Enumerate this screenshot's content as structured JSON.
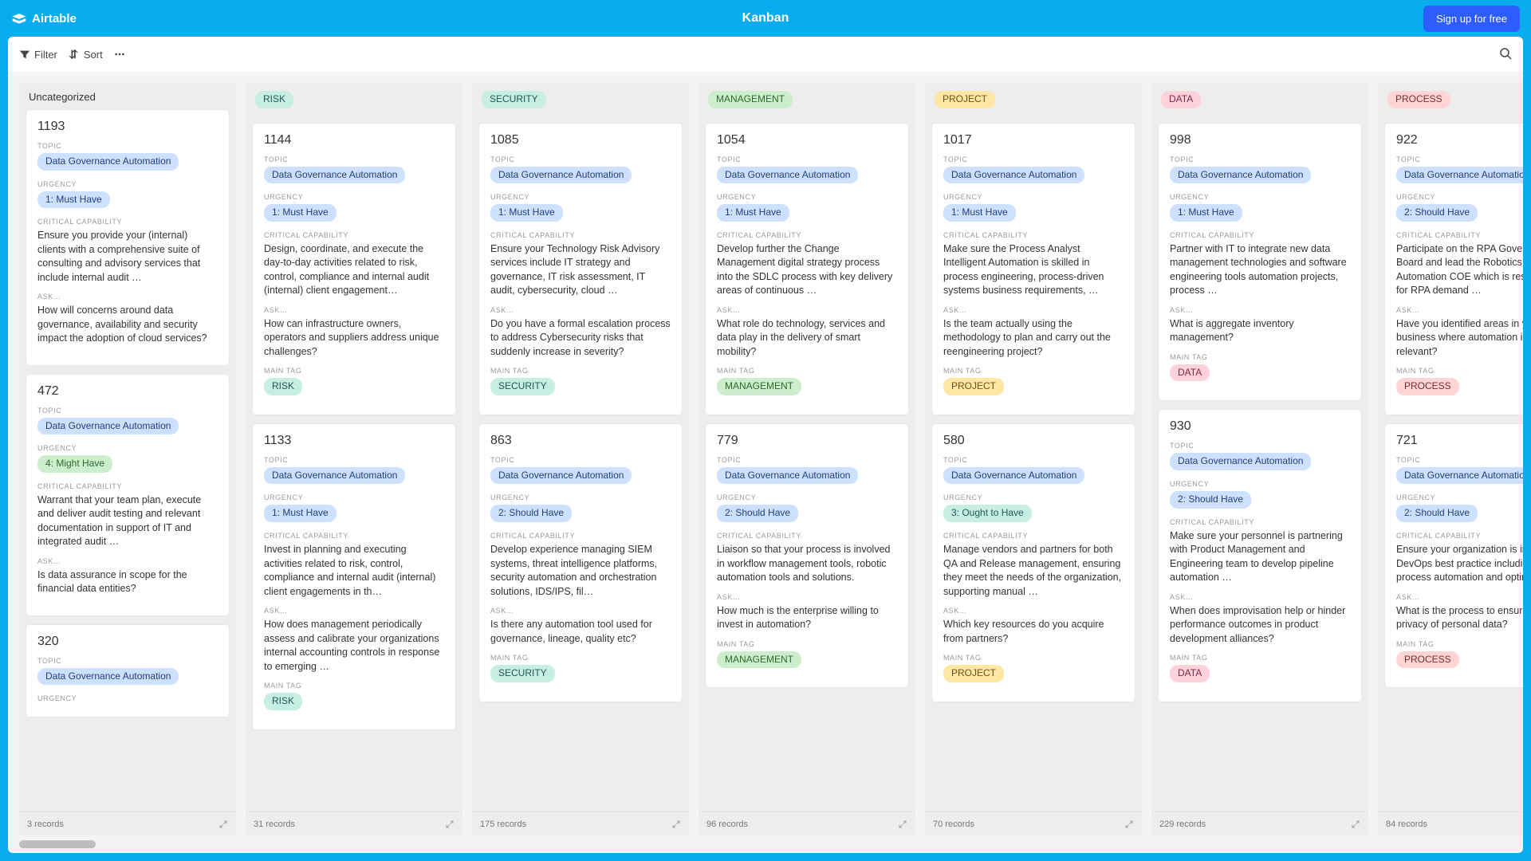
{
  "app": {
    "name": "Airtable",
    "view_title": "Kanban",
    "signup_label": "Sign up for free"
  },
  "toolbar": {
    "filter": "Filter",
    "sort": "Sort"
  },
  "labels": {
    "topic": "TOPIC",
    "urgency": "URGENCY",
    "critical": "CRITICAL CAPABILITY",
    "ask": "ASK…",
    "maintag": "MAIN TAG"
  },
  "pill_for_urgency": {
    "1: Must Have": "pill-blue",
    "2: Should Have": "pill-blue",
    "3: Ought to Have": "pill-teal",
    "4: Might Have": "pill-green"
  },
  "pill_for_tag": {
    "RISK": "pill-teal",
    "SECURITY": "pill-teal",
    "MANAGEMENT": "pill-green",
    "PROJECT": "pill-yellow",
    "DATA": "pill-pink",
    "PROCESS": "pill-red"
  },
  "columns": [
    {
      "key": "uncat",
      "title": "Uncategorized",
      "title_pill": null,
      "records_label": "3 records",
      "cards": [
        {
          "id": "1193",
          "topic": "Data Governance Automation",
          "urgency": "1: Must Have",
          "critical": "Ensure you provide your (internal) clients with a comprehensive suite of consulting and advisory services that include internal audit …",
          "ask": "How will concerns around data governance, availability and security impact the adoption of cloud services?",
          "main_tag": null
        },
        {
          "id": "472",
          "topic": "Data Governance Automation",
          "urgency": "4: Might Have",
          "critical": "Warrant that your team plan, execute and deliver audit testing and relevant documentation in support of IT and integrated audit …",
          "ask": "Is data assurance in scope for the financial data entities?",
          "main_tag": null
        },
        {
          "id": "320",
          "topic": "Data Governance Automation",
          "urgency": "",
          "critical": "",
          "ask": "",
          "main_tag": null,
          "truncated": true
        }
      ]
    },
    {
      "key": "risk",
      "title": "RISK",
      "title_pill": "pill-teal",
      "records_label": "31 records",
      "cards": [
        {
          "id": "1144",
          "topic": "Data Governance Automation",
          "urgency": "1: Must Have",
          "critical": "Design, coordinate, and execute the day-to-day activities related to risk, control, compliance and internal audit (internal) client engagement…",
          "ask": "How can infrastructure owners, operators and suppliers address unique challenges?",
          "main_tag": "RISK"
        },
        {
          "id": "1133",
          "topic": "Data Governance Automation",
          "urgency": "1: Must Have",
          "critical": "Invest in planning and executing activities related to risk, control, compliance and internal audit (internal) client engagements in th…",
          "ask": "How does management periodically assess and calibrate your organizations internal accounting controls in response to emerging …",
          "main_tag": "RISK"
        }
      ]
    },
    {
      "key": "security",
      "title": "SECURITY",
      "title_pill": "pill-teal",
      "records_label": "175 records",
      "cards": [
        {
          "id": "1085",
          "topic": "Data Governance Automation",
          "urgency": "1: Must Have",
          "critical": "Ensure your Technology Risk Advisory services include IT strategy and governance, IT risk assessment, IT audit, cybersecurity, cloud …",
          "ask": "Do you have a formal escalation process to address Cybersecurity risks that suddenly increase in severity?",
          "main_tag": "SECURITY"
        },
        {
          "id": "863",
          "topic": "Data Governance Automation",
          "urgency": "2: Should Have",
          "critical": "Develop experience managing SIEM systems, threat intelligence platforms, security automation and orchestration solutions, IDS/IPS, fil…",
          "ask": "Is there any automation tool used for governance, lineage, quality etc?",
          "main_tag": "SECURITY"
        }
      ]
    },
    {
      "key": "management",
      "title": "MANAGEMENT",
      "title_pill": "pill-green",
      "records_label": "96 records",
      "cards": [
        {
          "id": "1054",
          "topic": "Data Governance Automation",
          "urgency": "1: Must Have",
          "critical": "Develop further the Change Management digital strategy process into the SDLC process with key delivery areas of continuous …",
          "ask": "What role do technology, services and data play in the delivery of smart mobility?",
          "main_tag": "MANAGEMENT"
        },
        {
          "id": "779",
          "topic": "Data Governance Automation",
          "urgency": "2: Should Have",
          "critical": "Liaison so that your process is involved in workflow management tools, robotic automation tools and solutions.",
          "ask": "How much is the enterprise willing to invest in automation?",
          "main_tag": "MANAGEMENT"
        }
      ]
    },
    {
      "key": "project",
      "title": "PROJECT",
      "title_pill": "pill-yellow",
      "records_label": "70 records",
      "cards": [
        {
          "id": "1017",
          "topic": "Data Governance Automation",
          "urgency": "1: Must Have",
          "critical": "Make sure the Process Analyst Intelligent Automation is skilled in process engineering, process-driven systems business requirements, …",
          "ask": "Is the team actually using the methodology to plan and carry out the reengineering project?",
          "main_tag": "PROJECT"
        },
        {
          "id": "580",
          "topic": "Data Governance Automation",
          "urgency": "3: Ought to Have",
          "critical": "Manage vendors and partners for both QA and Release management, ensuring they meet the needs of the organization, supporting manual …",
          "ask": "Which key resources do you acquire from partners?",
          "main_tag": "PROJECT"
        }
      ]
    },
    {
      "key": "data",
      "title": "DATA",
      "title_pill": "pill-pink",
      "records_label": "229 records",
      "cards": [
        {
          "id": "998",
          "topic": "Data Governance Automation",
          "urgency": "1: Must Have",
          "critical": "Partner with IT to integrate new data management technologies and software engineering tools automation projects, process …",
          "ask": "What is aggregate inventory management?",
          "main_tag": "DATA"
        },
        {
          "id": "930",
          "topic": "Data Governance Automation",
          "urgency": "2: Should Have",
          "critical": "Make sure your personnel is partnering with Product Management and Engineering team to develop pipeline automation …",
          "ask": "When does improvisation help or hinder performance outcomes in product development alliances?",
          "main_tag": "DATA"
        }
      ]
    },
    {
      "key": "process",
      "title": "PROCESS",
      "title_pill": "pill-red",
      "records_label": "84 records",
      "cards": [
        {
          "id": "922",
          "topic": "Data Governance Automation",
          "urgency": "2: Should Have",
          "critical": "Participate on the RPA Governance Board and lead the Robotics Process Automation COE which is responsible for RPA demand …",
          "ask": "Have you identified areas in your business where automation is most relevant?",
          "main_tag": "PROCESS"
        },
        {
          "id": "721",
          "topic": "Data Governance Automation",
          "urgency": "2: Should Have",
          "critical": "Ensure your organization is involved in DevOps best practice including CI/CD, process automation and optimization.",
          "ask": "What is the process to ensure the privacy of personal data?",
          "main_tag": "PROCESS"
        }
      ]
    }
  ]
}
